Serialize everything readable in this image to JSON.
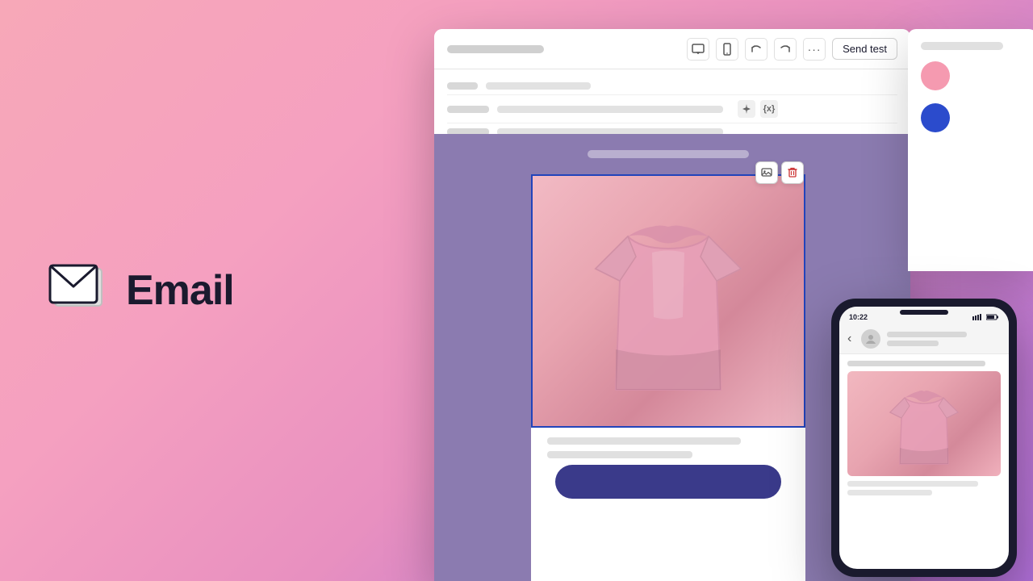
{
  "app": {
    "title": "Email",
    "brand_label": "Email"
  },
  "toolbar": {
    "send_test_label": "Send test",
    "undo_icon": "↩",
    "redo_icon": "↪",
    "more_icon": "•••",
    "desktop_icon": "🖥",
    "mobile_icon": "📱"
  },
  "form": {
    "rows": [
      {
        "label_width": 40,
        "value_width": 120
      },
      {
        "label_width": 55,
        "value_width": 240
      },
      {
        "label_width": 55,
        "value_width": 240
      }
    ]
  },
  "canvas": {
    "header_bar_color": "#8b7bb0",
    "email_bg": "#ffffff",
    "purple_bg": "#8b7bb0"
  },
  "image_block": {
    "selected": true,
    "border_color": "#2244bb",
    "shirt_bg": "linear-gradient(135deg, #f2b8c0, #e8a0b0, #d48090)"
  },
  "right_panel": {
    "swatch1_color": "#f59ab0",
    "swatch2_color": "#2b4bcc"
  },
  "mobile_preview": {
    "time": "10:22",
    "signal": "●●●",
    "battery": "▮▮▮"
  },
  "footer": {
    "cta_color": "#3a3a8a"
  }
}
